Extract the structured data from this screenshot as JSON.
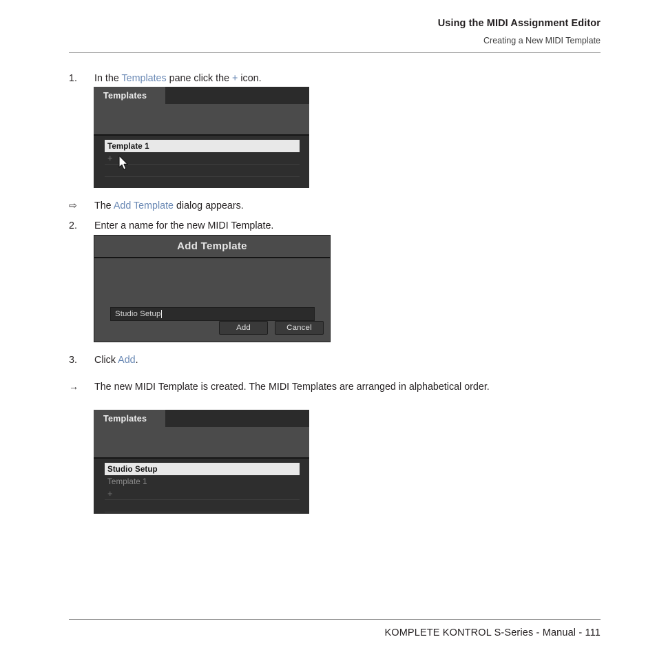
{
  "header": {
    "title": "Using the MIDI Assignment Editor",
    "subtitle": "Creating a New MIDI Template"
  },
  "footer": {
    "text": "KOMPLETE KONTROL S-Series - Manual - 111"
  },
  "steps": {
    "step1": {
      "marker": "1.",
      "text_before": "In the ",
      "link1": "Templates",
      "text_mid": " pane click the ",
      "link2": "+",
      "text_after": " icon."
    },
    "result1": {
      "marker": "⇨",
      "text_before": "The ",
      "link": "Add Template",
      "text_after": " dialog appears."
    },
    "step2": {
      "marker": "2.",
      "text": "Enter a name for the new MIDI Template."
    },
    "step3": {
      "marker": "3.",
      "text_before": "Click ",
      "link": "Add",
      "text_after": "."
    },
    "result2": {
      "marker": "→",
      "text": "The new MIDI Template is created. The MIDI Templates are arranged in alphabetical order."
    }
  },
  "panel_before": {
    "tab_label": "Templates",
    "rows": [
      {
        "label": "Template 1",
        "state": "selected"
      },
      {
        "label": "+",
        "state": "plus"
      },
      {
        "label": "",
        "state": "empty"
      }
    ]
  },
  "panel_after": {
    "tab_label": "Templates",
    "rows": [
      {
        "label": "Studio Setup",
        "state": "selected"
      },
      {
        "label": "Template 1",
        "state": "normal"
      },
      {
        "label": "+",
        "state": "plus"
      },
      {
        "label": "",
        "state": "empty"
      }
    ]
  },
  "dialog": {
    "title": "Add Template",
    "input_value": "Studio Setup",
    "add_label": "Add",
    "cancel_label": "Cancel"
  },
  "colors": {
    "link": "#6988b4",
    "panel_bg": "#2e2e2e",
    "panel_tool": "#4b4b4b",
    "selected_row": "#e8e8e8",
    "text": "#231f20"
  }
}
